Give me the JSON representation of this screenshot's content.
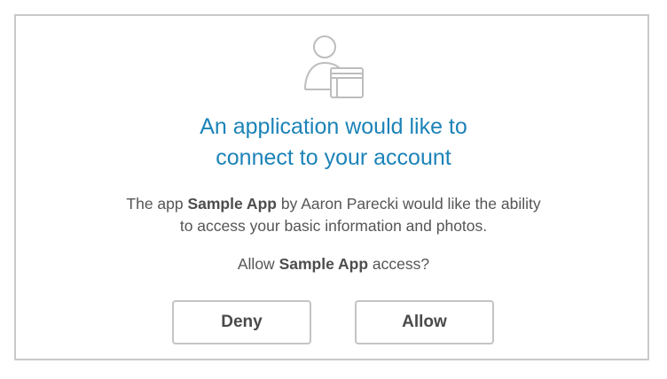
{
  "dialog": {
    "icon": "user-with-window-icon",
    "title_line1": "An application would like to",
    "title_line2": "connect to your account",
    "desc_line1_pre": "The app ",
    "app_name": "Sample App",
    "desc_line1_mid": " by Aaron Parecki would like the ability",
    "desc_line2": "to access your basic information and photos.",
    "question_pre": "Allow ",
    "question_post": " access?"
  },
  "buttons": {
    "deny_label": "Deny",
    "allow_label": "Allow"
  },
  "colors": {
    "title": "#1c83b8",
    "text": "#555555",
    "border": "#c9c9c9",
    "icon": "#bdbdbd"
  }
}
